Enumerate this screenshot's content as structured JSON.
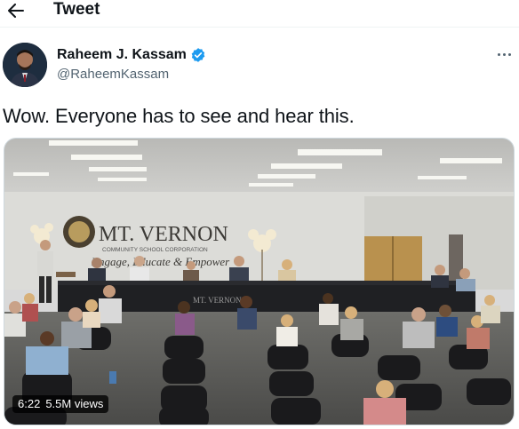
{
  "header": {
    "title": "Tweet",
    "back_icon": "arrow-left-icon"
  },
  "author": {
    "name": "Raheem J. Kassam",
    "handle": "@RaheemKassam",
    "verified_icon": "verified-badge-icon",
    "verified_color": "#1d9bf0"
  },
  "tweet": {
    "text": "Wow. Everyone has to see and hear this."
  },
  "media": {
    "type": "video",
    "duration": "6:22",
    "views": "5.5M views",
    "scene": {
      "banner_name": "MT. VERNON",
      "banner_sub": "COMMUNITY SCHOOL CORPORATION",
      "banner_tagline": "Engage, Educate & Empower",
      "table_skirt": "MT. VERNON"
    }
  },
  "colors": {
    "text_primary": "#0f1419",
    "text_secondary": "#536471",
    "accent": "#1d9bf0"
  }
}
